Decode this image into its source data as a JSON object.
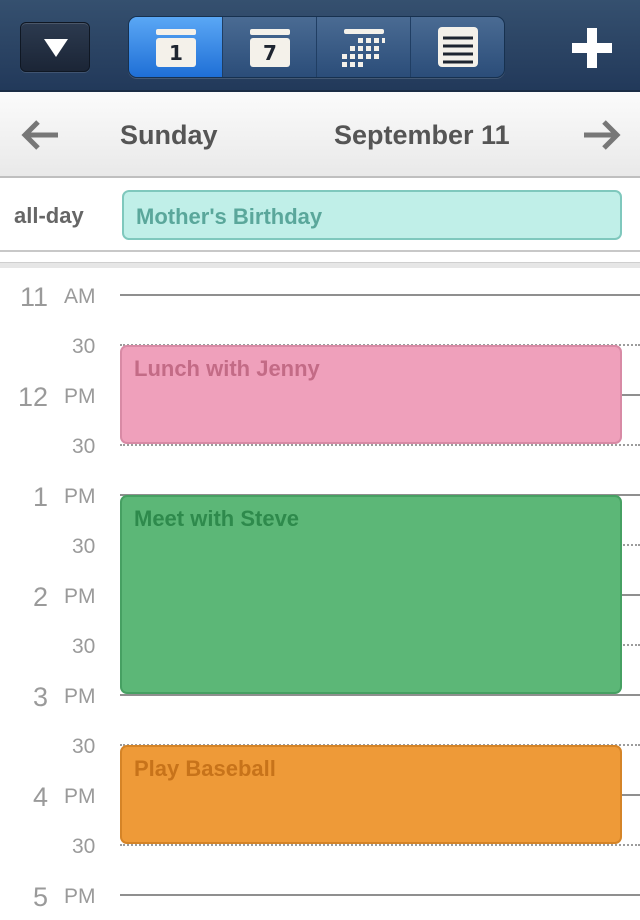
{
  "toolbar": {
    "views": [
      "1",
      "7"
    ],
    "add_icon": "plus-icon",
    "menu_icon": "triangle-down-icon"
  },
  "date_nav": {
    "day": "Sunday",
    "date": "September 11"
  },
  "all_day": {
    "label": "all-day",
    "event": "Mother's Birthday"
  },
  "timeline": {
    "rows": [
      {
        "hour": "11",
        "ampm": "AM",
        "half": "30"
      },
      {
        "hour": "12",
        "ampm": "PM",
        "half": "30"
      },
      {
        "hour": "1",
        "ampm": "PM",
        "half": "30"
      },
      {
        "hour": "2",
        "ampm": "PM",
        "half": "30"
      },
      {
        "hour": "3",
        "ampm": "PM",
        "half": "30"
      },
      {
        "hour": "4",
        "ampm": "PM",
        "half": "30"
      },
      {
        "hour": "5",
        "ampm": "PM",
        "half": ""
      }
    ]
  },
  "events": [
    {
      "title": "Lunch with Jenny",
      "color": "#efa0bb"
    },
    {
      "title": "Meet with Steve",
      "color": "#5cb777"
    },
    {
      "title": "Play Baseball",
      "color": "#ee9a38"
    }
  ]
}
